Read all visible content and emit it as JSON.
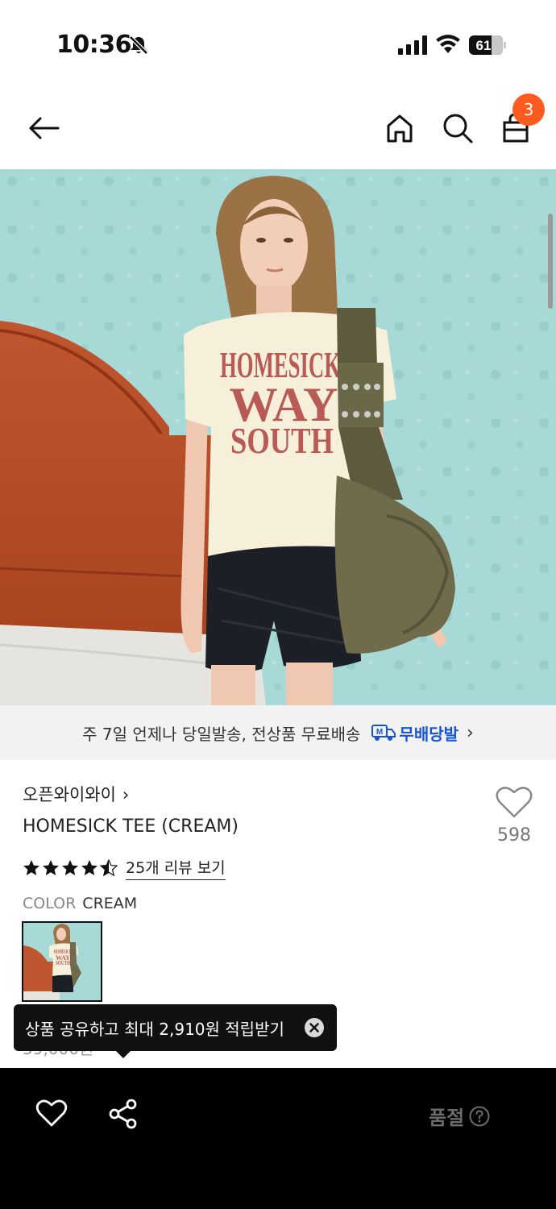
{
  "status_bar": {
    "time": "10:36",
    "battery": "61"
  },
  "header": {
    "cart_count": "3"
  },
  "hero": {
    "tee_lines": [
      "HOMESICK",
      "WAY",
      "SOUTH"
    ]
  },
  "delivery": {
    "text": "주 7일 언제나 당일발송, 전상품 무료배송",
    "badge_logo": "M",
    "badge_label": "무배당발",
    "chevron": "›"
  },
  "product": {
    "brand": "오픈와이와이",
    "brand_chevron": "›",
    "name": "HOMESICK TEE (CREAM)",
    "wish_count": "598",
    "rating": 4.5,
    "review_link": "25개 리뷰 보기",
    "color_label": "COLOR",
    "color_value": "CREAM",
    "price_partial": "39,000원",
    "swatch_tee_lines": [
      "HOMESICK",
      "WAY",
      "SOUTH"
    ]
  },
  "tooltip": {
    "text": "상품 공유하고 최대 2,910원 적립받기"
  },
  "bottom_bar": {
    "status_label": "품절"
  },
  "colors": {
    "accent": "#ff5a1f",
    "brand_blue": "#1555d6",
    "banner_bg": "#f2f2f2",
    "bottom_bg": "#000000"
  }
}
